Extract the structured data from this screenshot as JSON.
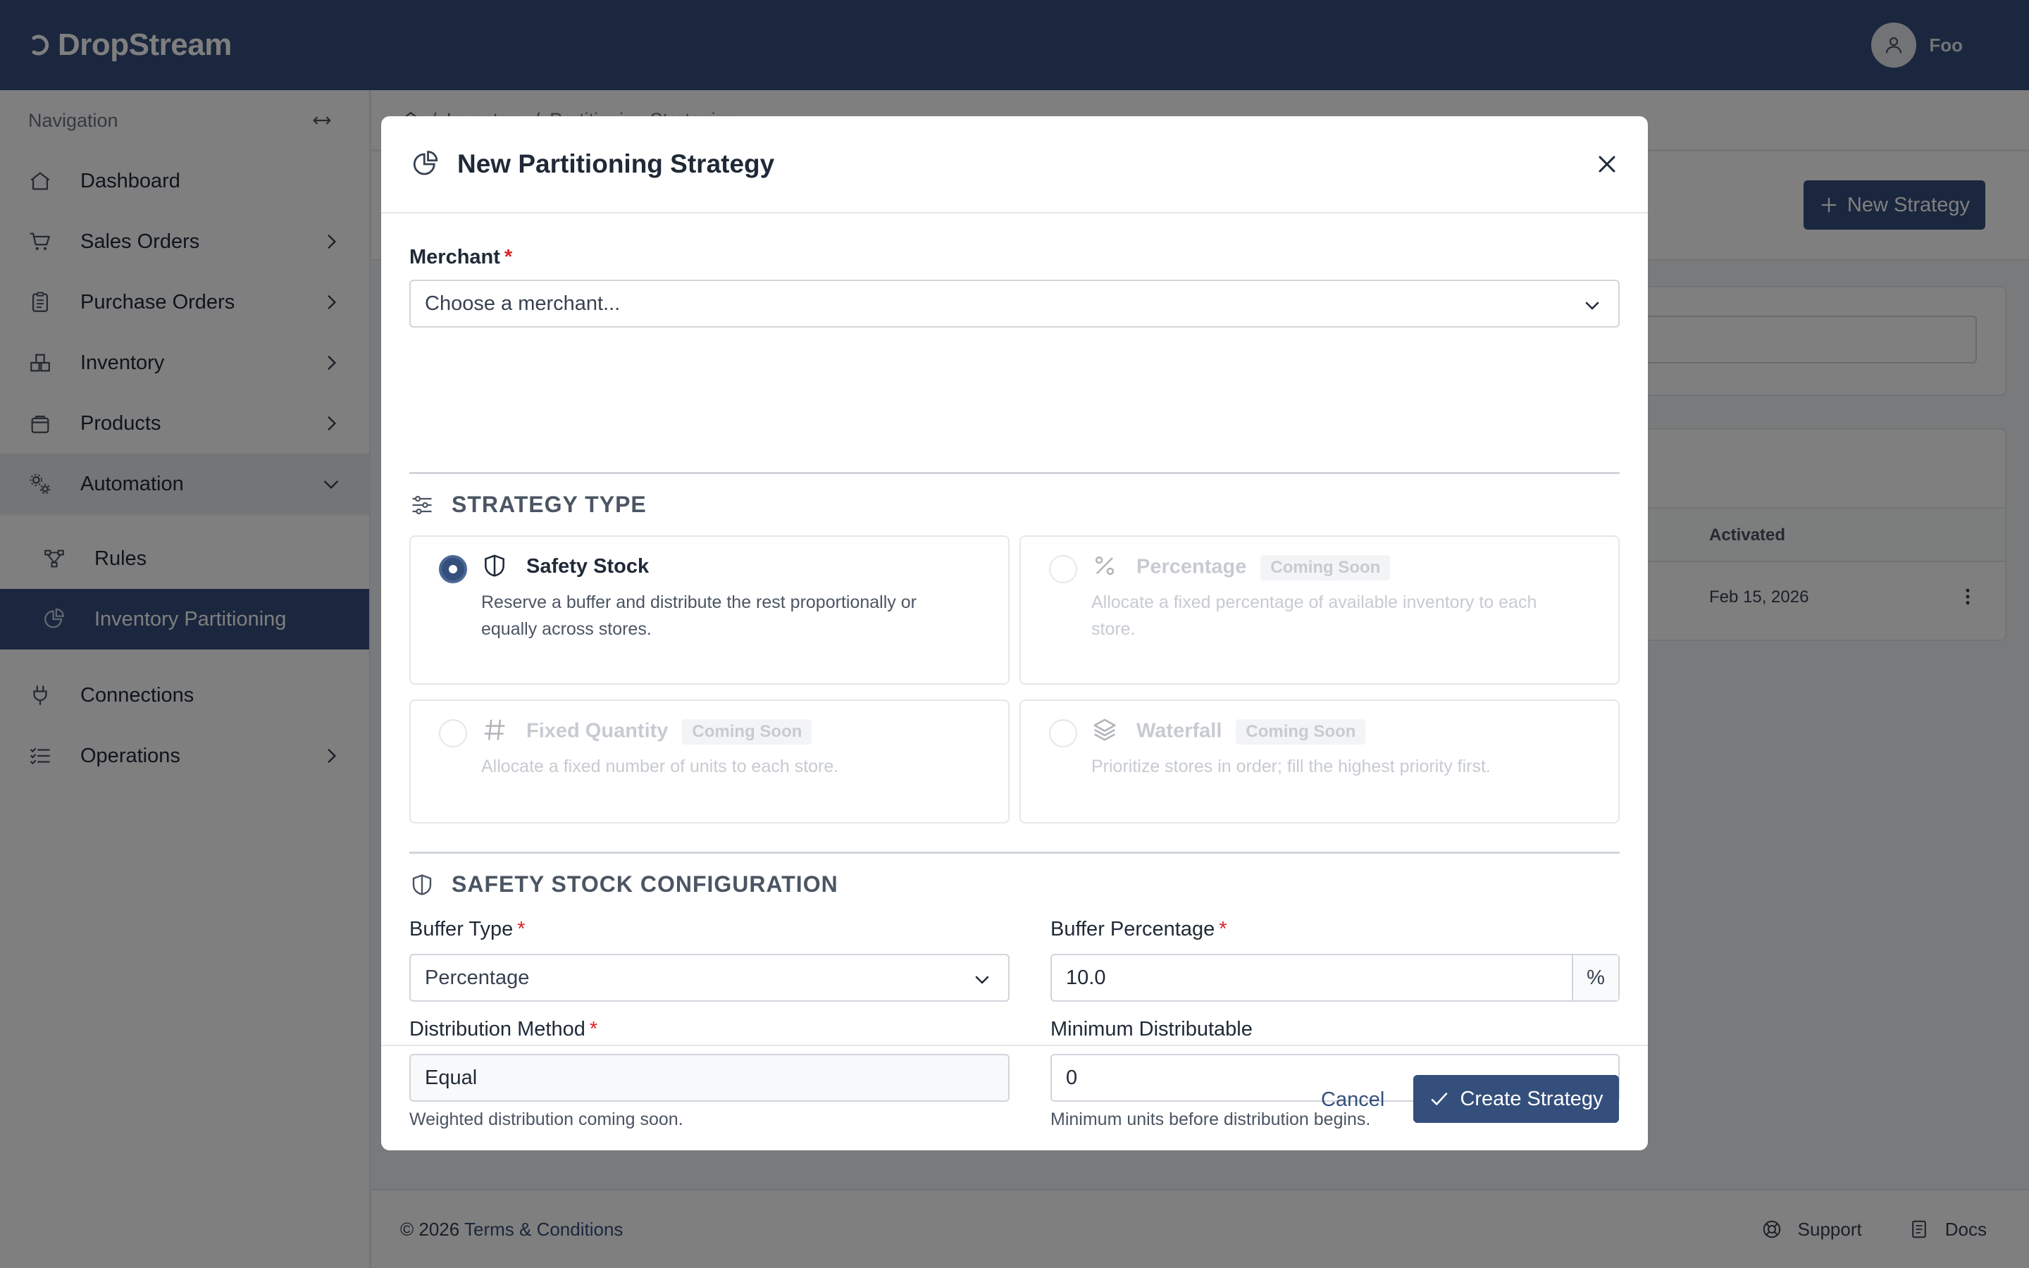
{
  "app": {
    "brand": "DropStream",
    "user_name": "Foo"
  },
  "sidebar": {
    "heading": "Navigation",
    "items": [
      {
        "label": "Dashboard",
        "icon": "home-icon"
      },
      {
        "label": "Sales Orders",
        "icon": "cart-icon"
      },
      {
        "label": "Purchase Orders",
        "icon": "clipboard-icon"
      },
      {
        "label": "Inventory",
        "icon": "boxes-icon"
      },
      {
        "label": "Products",
        "icon": "bag-icon"
      },
      {
        "label": "Automation",
        "icon": "gears-icon"
      },
      {
        "label": "Connections",
        "icon": "plug-icon"
      },
      {
        "label": "Operations",
        "icon": "list-check-icon"
      }
    ],
    "sub_items": [
      {
        "label": "Rules",
        "icon": "diagram-icon"
      },
      {
        "label": "Inventory Partitioning",
        "icon": "pie-chart-icon"
      }
    ]
  },
  "page": {
    "breadcrumb": [
      "Inventory",
      "Partitioning Strategies"
    ],
    "new_button": "New Strategy",
    "table": {
      "col_activated": "Activated",
      "rows": [
        {
          "activated": "Feb 15, 2026"
        }
      ]
    }
  },
  "footer": {
    "copyright": "© 2026",
    "terms": "Terms & Conditions",
    "support": "Support",
    "docs": "Docs"
  },
  "modal": {
    "title": "New Partitioning Strategy",
    "merchant": {
      "label": "Merchant",
      "required": "*",
      "placeholder": "Choose a merchant..."
    },
    "strategy_section": "STRATEGY TYPE",
    "strategies": [
      {
        "title": "Safety Stock",
        "desc": "Reserve a buffer and distribute the rest proportionally or equally across stores."
      },
      {
        "title": "Percentage",
        "badge": "Coming Soon",
        "desc": "Allocate a fixed percentage of available inventory to each store."
      },
      {
        "title": "Fixed Quantity",
        "badge": "Coming Soon",
        "desc": "Allocate a fixed number of units to each store."
      },
      {
        "title": "Waterfall",
        "badge": "Coming Soon",
        "desc": "Prioritize stores in order; fill the highest priority first."
      }
    ],
    "config_section": "SAFETY STOCK CONFIGURATION",
    "buffer_type": {
      "label": "Buffer Type",
      "required": "*",
      "value": "Percentage"
    },
    "buffer_percentage": {
      "label": "Buffer Percentage",
      "required": "*",
      "value": "10.0",
      "suffix": "%"
    },
    "distribution_method": {
      "label": "Distribution Method",
      "required": "*",
      "value": "Equal",
      "help": "Weighted distribution coming soon."
    },
    "minimum_distributable": {
      "label": "Minimum Distributable",
      "value": "0",
      "help": "Minimum units before distribution begins."
    },
    "cancel": "Cancel",
    "create": "Create Strategy"
  },
  "colors": {
    "primary": "#354f7c",
    "required": "#dc2626"
  }
}
